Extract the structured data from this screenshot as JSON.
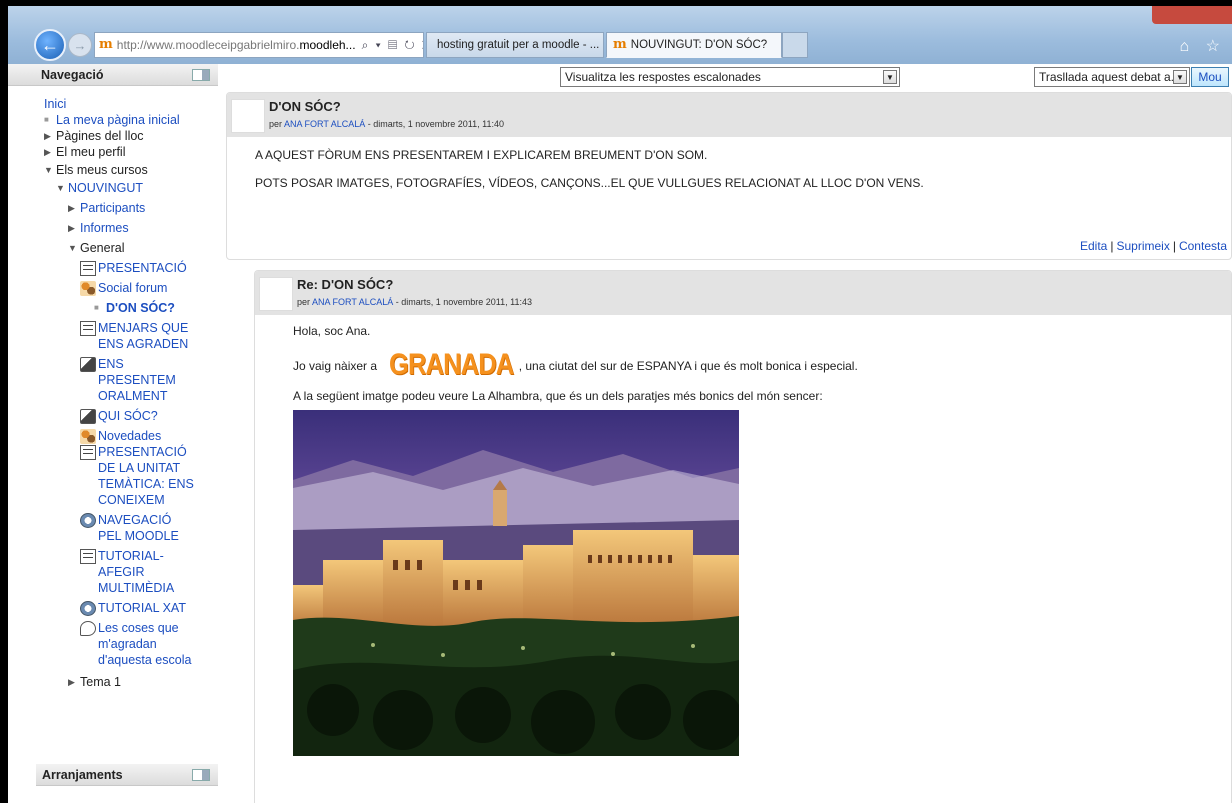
{
  "browser": {
    "address_prefix": "http://www.moodleceipgabrielmiro.",
    "address_domain": "moodleh...",
    "address_tools": "⌕ ▾ ▤ ↻ ✕",
    "tabs": [
      {
        "label": "hosting gratuit per a moodle - ..."
      },
      {
        "label": "NOUVINGUT: D'ON SÓC?",
        "close": "×"
      }
    ],
    "toolbar_icons": "⌂ ☆"
  },
  "sidebar": {
    "navigation_title": "Navegació",
    "items": {
      "inici": "Inici",
      "home": "La meva pàgina inicial",
      "site_pages": "Pàgines del lloc",
      "profile": "El meu perfil",
      "my_courses": "Els meus cursos",
      "course": "NOUVINGUT",
      "participants": "Participants",
      "reports": "Informes",
      "general": "General",
      "presentacio": "PRESENTACIÓ",
      "social_forum": "Social forum",
      "don_soc": "D'ON SÓC?",
      "menjars_1": "MENJARS QUE",
      "menjars_2": "ENS AGRADEN",
      "ens_pres_1": "ENS",
      "ens_pres_2": "PRESENTEM",
      "ens_pres_3": "ORALMENT",
      "qui_soc": "QUI SÓC?",
      "novedades": "Novedades",
      "pres_unitat_1": "PRESENTACIÓ",
      "pres_unitat_2": "DE LA UNITAT",
      "pres_unitat_3": "TEMÀTICA: ENS",
      "pres_unitat_4": "CONEIXEM",
      "navegacio_1": "NAVEGACIÓ",
      "navegacio_2": "PEL MOODLE",
      "tutorial_1": "TUTORIAL-",
      "tutorial_2": "AFEGIR",
      "tutorial_3": "MULTIMÈDIA",
      "tutorial_xat": "TUTORIAL XAT",
      "coses_1": "Les coses que",
      "coses_2": "m'agradan",
      "coses_3": "d'aquesta escola",
      "tema1": "Tema 1"
    },
    "settings_title": "Arranjaments"
  },
  "main": {
    "display_mode": "Visualitza les respostes escalonades",
    "move_select": "Trasllada aquest debat a...",
    "move_button": "Mou",
    "post1": {
      "subject": "D'ON SÓC?",
      "by": "per",
      "author": "ANA FORT ALCALÁ",
      "date": " - dimarts, 1 novembre 2011, 11:40",
      "line1": "A AQUEST FÒRUM ENS PRESENTAREM I EXPLICAREM BREUMENT D'ON SOM.",
      "line2": "POTS POSAR IMATGES, FOTOGRAFÍES, VÍDEOS, CANÇONS...EL QUE VULLGUES RELACIONAT AL LLOC D'ON VENS.",
      "edit": "Edita",
      "delete": "Suprimeix",
      "reply": "Contesta"
    },
    "post2": {
      "subject": "Re: D'ON SÓC?",
      "by": "per",
      "author": "ANA FORT ALCALÁ",
      "date": " - dimarts, 1 novembre 2011, 11:43",
      "greeting": "Hola, soc Ana.",
      "born_pre": "Jo vaig nàixer a ",
      "city": "GRANADA",
      "born_post": ", una ciutat del sur de ESPANYA i que és molt bonica i especial.",
      "image_intro": "A la següent imatge podeu veure La Alhambra, que és un dels paratjes més bonics del món sencer:"
    }
  },
  "colors": {
    "link": "#1c4ec0",
    "header_gray": "#e3e3e3",
    "accent_orange": "#f5911e"
  }
}
